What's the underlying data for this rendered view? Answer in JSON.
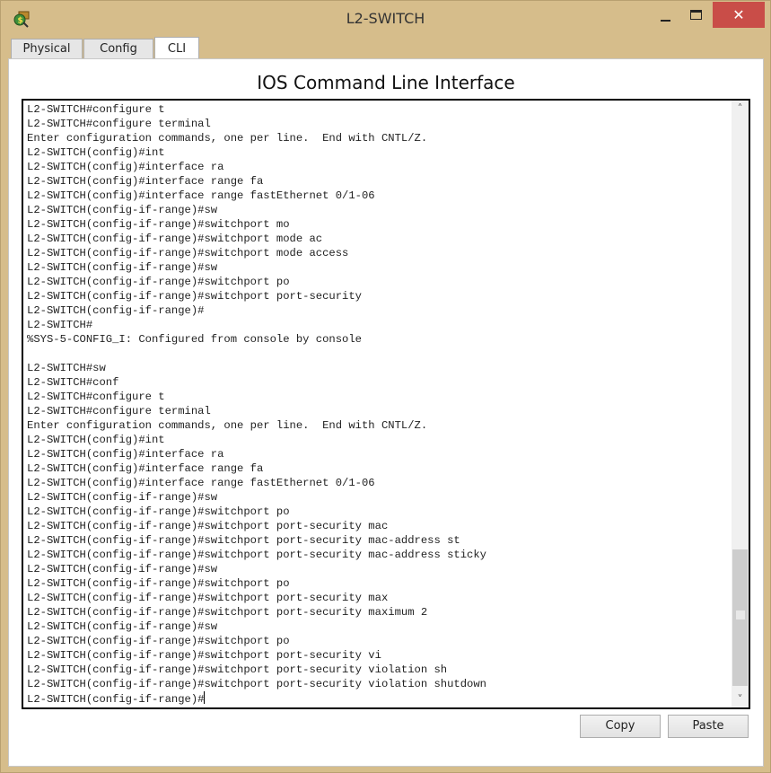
{
  "window": {
    "title": "L2-SWITCH",
    "app_icon": "packet-tracer-switch-icon",
    "controls": {
      "minimize": "minimize-icon",
      "maximize": "maximize-icon",
      "close": "✕"
    }
  },
  "tabs": [
    {
      "label": "Physical",
      "active": false
    },
    {
      "label": "Config",
      "active": false
    },
    {
      "label": "CLI",
      "active": true
    }
  ],
  "cli": {
    "heading": "IOS Command Line Interface",
    "lines": [
      "L2-SWITCH#configure t",
      "L2-SWITCH#configure terminal",
      "Enter configuration commands, one per line.  End with CNTL/Z.",
      "L2-SWITCH(config)#int",
      "L2-SWITCH(config)#interface ra",
      "L2-SWITCH(config)#interface range fa",
      "L2-SWITCH(config)#interface range fastEthernet 0/1-06",
      "L2-SWITCH(config-if-range)#sw",
      "L2-SWITCH(config-if-range)#switchport mo",
      "L2-SWITCH(config-if-range)#switchport mode ac",
      "L2-SWITCH(config-if-range)#switchport mode access",
      "L2-SWITCH(config-if-range)#sw",
      "L2-SWITCH(config-if-range)#switchport po",
      "L2-SWITCH(config-if-range)#switchport port-security",
      "L2-SWITCH(config-if-range)#",
      "L2-SWITCH#",
      "%SYS-5-CONFIG_I: Configured from console by console",
      "",
      "L2-SWITCH#sw",
      "L2-SWITCH#conf",
      "L2-SWITCH#configure t",
      "L2-SWITCH#configure terminal",
      "Enter configuration commands, one per line.  End with CNTL/Z.",
      "L2-SWITCH(config)#int",
      "L2-SWITCH(config)#interface ra",
      "L2-SWITCH(config)#interface range fa",
      "L2-SWITCH(config)#interface range fastEthernet 0/1-06",
      "L2-SWITCH(config-if-range)#sw",
      "L2-SWITCH(config-if-range)#switchport po",
      "L2-SWITCH(config-if-range)#switchport port-security mac",
      "L2-SWITCH(config-if-range)#switchport port-security mac-address st",
      "L2-SWITCH(config-if-range)#switchport port-security mac-address sticky",
      "L2-SWITCH(config-if-range)#sw",
      "L2-SWITCH(config-if-range)#switchport po",
      "L2-SWITCH(config-if-range)#switchport port-security max",
      "L2-SWITCH(config-if-range)#switchport port-security maximum 2",
      "L2-SWITCH(config-if-range)#sw",
      "L2-SWITCH(config-if-range)#switchport po",
      "L2-SWITCH(config-if-range)#switchport port-security vi",
      "L2-SWITCH(config-if-range)#switchport port-security violation sh",
      "L2-SWITCH(config-if-range)#switchport port-security violation shutdown"
    ],
    "prompt": "L2-SWITCH(config-if-range)#",
    "scroll_position": "bottom",
    "scrollbar": {
      "up": "˄",
      "down": "˅"
    }
  },
  "buttons": {
    "copy": "Copy",
    "paste": "Paste"
  }
}
